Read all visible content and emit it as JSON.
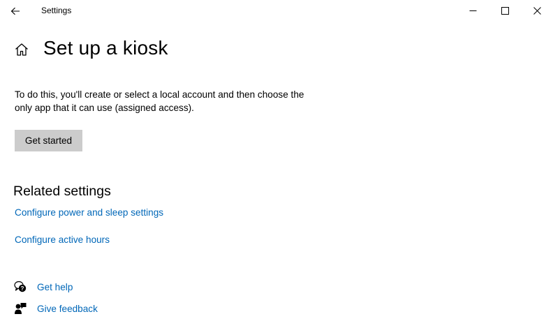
{
  "window": {
    "app_title": "Settings",
    "icons": {
      "back": "back-arrow-icon",
      "minimize": "minimize-icon",
      "maximize": "maximize-icon",
      "close": "close-icon"
    }
  },
  "header": {
    "home_icon": "home-icon",
    "title": "Set up a kiosk"
  },
  "main": {
    "description": "To do this, you'll create or select a local account and then choose the only app that it can use (assigned access).",
    "get_started_label": "Get started"
  },
  "related": {
    "title": "Related settings",
    "links": [
      {
        "label": "Configure power and sleep settings"
      },
      {
        "label": "Configure active hours"
      }
    ]
  },
  "support": {
    "items": [
      {
        "label": "Get help",
        "icon": "get-help-icon"
      },
      {
        "label": "Give feedback",
        "icon": "feedback-icon"
      }
    ]
  },
  "colors": {
    "link": "#0067b8",
    "button_bg": "#cccccc",
    "background": "#ffffff"
  }
}
